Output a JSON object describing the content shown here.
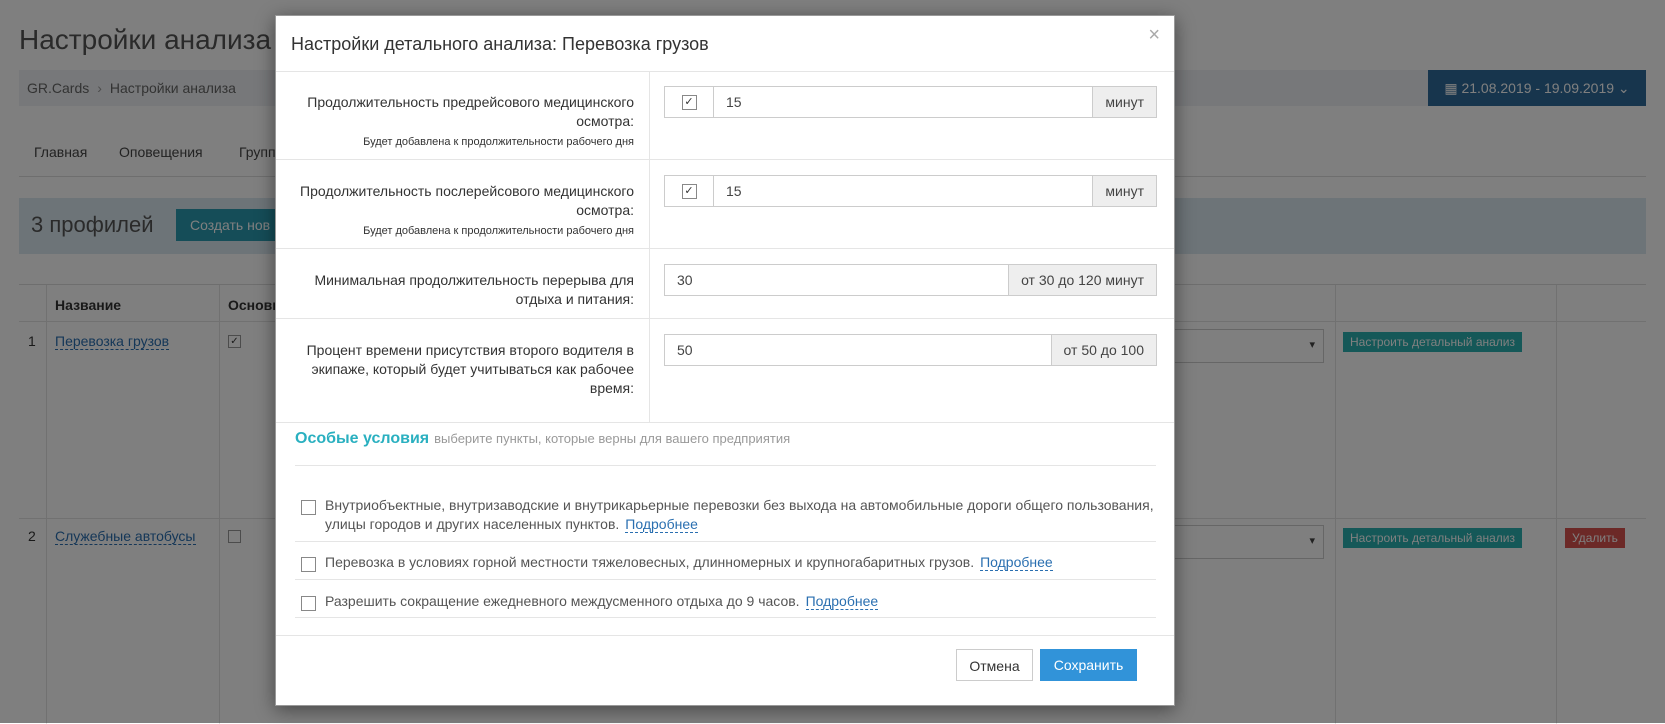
{
  "background": {
    "page_title": "Настройки анализа",
    "breadcrumb": [
      "GR.Cards",
      "Настройки анализа"
    ],
    "breadcrumb_sep": "›",
    "date_range": "21.08.2019 - 19.09.2019",
    "tabs": [
      "Главная",
      "Оповещения",
      "Групп"
    ],
    "profile_count": "3 профилей",
    "create_button": "Создать нов",
    "columns": [
      "Название",
      "Основн"
    ],
    "rows": [
      {
        "num": "1",
        "name": "Перевозка грузов",
        "checked": "✓",
        "action": "Настроить детальный анализ"
      },
      {
        "num": "2",
        "name": "Служебные автобусы",
        "checked": "",
        "action": "Настроить детальный анализ",
        "delete": "Удалить"
      }
    ],
    "select_arrow": "▾",
    "date_chevron": "⌄"
  },
  "modal": {
    "title": "Настройки детального анализа: Перевозка грузов",
    "close": "×",
    "fields": [
      {
        "label": "Продолжительность предрейсового медицинского осмотра:",
        "hint": "Будет добавлена к продолжительности рабочего дня",
        "checked": "✓",
        "value": "15",
        "addon": "минут"
      },
      {
        "label": "Продолжительность послерейсового медицинского осмотра:",
        "hint": "Будет добавлена к продолжительности рабочего дня",
        "checked": "✓",
        "value": "15",
        "addon": "минут"
      },
      {
        "label": "Минимальная продолжительность перерыва для отдыха и питания:",
        "value": "30",
        "addon": "от 30 до 120 минут"
      },
      {
        "label": "Процент времени присутствия второго водителя в экипаже, который будет учитываться как рабочее время:",
        "value": "50",
        "addon": "от 50 до 100"
      }
    ],
    "special": {
      "heading": "Особые условия",
      "subheading": "выберите пункты, которые верны для вашего предприятия",
      "options": [
        {
          "text": "Внутриобъектные, внутризаводские и внутрикарьерные перевозки без выхода на автомобильные дороги общего пользования, улицы городов и других населенных пунктов.",
          "more": "Подробнее"
        },
        {
          "text": "Перевозка в условиях горной местности тяжеловесных, длинномерных и крупногабаритных грузов.",
          "more": "Подробнее"
        },
        {
          "text": "Разрешить сокращение ежедневного междусменного отдыха до 9 часов.",
          "more": "Подробнее"
        }
      ]
    },
    "cancel": "Отмена",
    "save": "Сохранить"
  }
}
